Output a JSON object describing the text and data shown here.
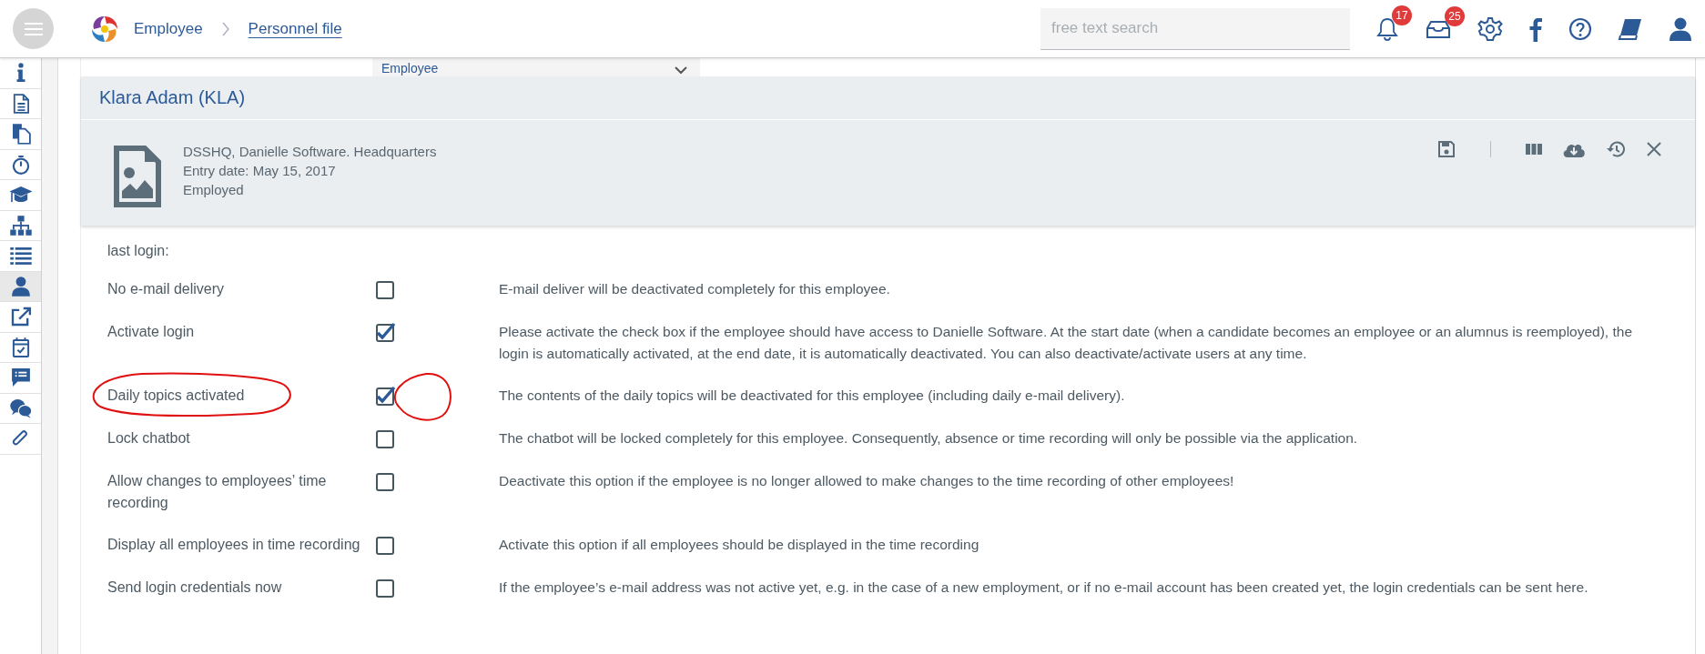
{
  "topbar": {
    "breadcrumb": [
      {
        "label": "Employee",
        "kind": "crumb"
      },
      {
        "label": "Personnel file",
        "kind": "link"
      }
    ],
    "search": {
      "placeholder": "free text search"
    },
    "notifications": {
      "count": "17"
    },
    "messages": {
      "count": "25"
    }
  },
  "sidebar": {
    "items": [
      {
        "selected": false
      },
      {
        "selected": false
      },
      {
        "selected": false
      },
      {
        "selected": false
      },
      {
        "selected": false
      },
      {
        "selected": false
      },
      {
        "selected": false
      },
      {
        "selected": true
      },
      {
        "selected": false
      },
      {
        "selected": false
      },
      {
        "selected": false
      },
      {
        "selected": false
      },
      {
        "selected": false
      }
    ]
  },
  "dropdown": {
    "value": "Employee"
  },
  "employee": {
    "name": "Klara Adam (KLA)",
    "details": [
      "DSSHQ, Danielle Software. Headquarters",
      "Entry date: May 15, 2017",
      "Employed"
    ]
  },
  "last_login": {
    "label": "last login:"
  },
  "settings": [
    {
      "label": "No e-mail delivery",
      "checked": false,
      "annotated": false,
      "description": "E-mail deliver will be deactivated completely for this employee."
    },
    {
      "label": "Activate login",
      "checked": true,
      "annotated": false,
      "description": "Please activate the check box if the employee should have access to Danielle Software. At the start date (when a candidate becomes an employee or an alumnus is reemployed), the login is automatically activated, at the end date, it is automatically deactivated. You can also deactivate/activate users at any time."
    },
    {
      "label": "Daily topics activated",
      "checked": true,
      "annotated": true,
      "description": "The contents of the daily topics will be deactivated for this employee (including daily e-mail delivery)."
    },
    {
      "label": "Lock chatbot",
      "checked": false,
      "annotated": false,
      "description": "The chatbot will be locked completely for this employee. Consequently, absence or time recording will only be possible via the application."
    },
    {
      "label": "Allow changes to employees’ time recording",
      "checked": false,
      "annotated": false,
      "description": "Deactivate this option if the employee is no longer allowed to make changes to the time recording of other employees!"
    },
    {
      "label": "Display all employees in time recording",
      "checked": false,
      "annotated": false,
      "description": "Activate this option if all employees should be displayed in the time recording"
    },
    {
      "label": "Send login credentials now",
      "checked": false,
      "annotated": false,
      "description": "If the employee’s e-mail address was not active yet, e.g. in the case of a new employment, or if no e-mail account has been created yet, the login credentials can be sent here."
    }
  ]
}
